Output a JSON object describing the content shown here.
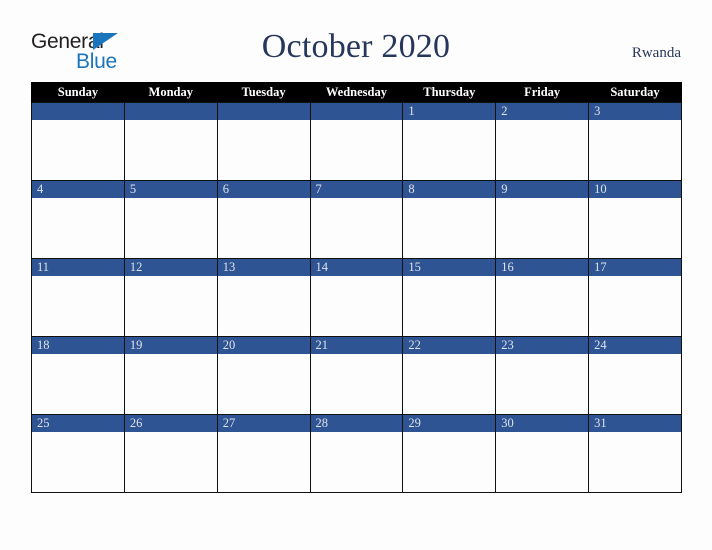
{
  "logo": {
    "word_one": "General",
    "word_two": "Blue",
    "triangle_icon": "blue-triangle-icon",
    "color_dark": "#231f20",
    "color_blue": "#1b75bc"
  },
  "header": {
    "title": "October 2020",
    "country": "Rwanda",
    "title_color": "#27375c"
  },
  "calendar": {
    "month": "October",
    "year": "2020",
    "weekday_headers": [
      "Sunday",
      "Monday",
      "Tuesday",
      "Wednesday",
      "Thursday",
      "Friday",
      "Saturday"
    ],
    "header_bg": "#000000",
    "header_text_color": "#ffffff",
    "daybar_bg": "#2e5494",
    "daybar_text_color": "#dfe3ea",
    "cell_bg": "#ffffff",
    "weeks": [
      [
        "",
        "",
        "",
        "",
        "1",
        "2",
        "3"
      ],
      [
        "4",
        "5",
        "6",
        "7",
        "8",
        "9",
        "10"
      ],
      [
        "11",
        "12",
        "13",
        "14",
        "15",
        "16",
        "17"
      ],
      [
        "18",
        "19",
        "20",
        "21",
        "22",
        "23",
        "24"
      ],
      [
        "25",
        "26",
        "27",
        "28",
        "29",
        "30",
        "31"
      ]
    ]
  }
}
